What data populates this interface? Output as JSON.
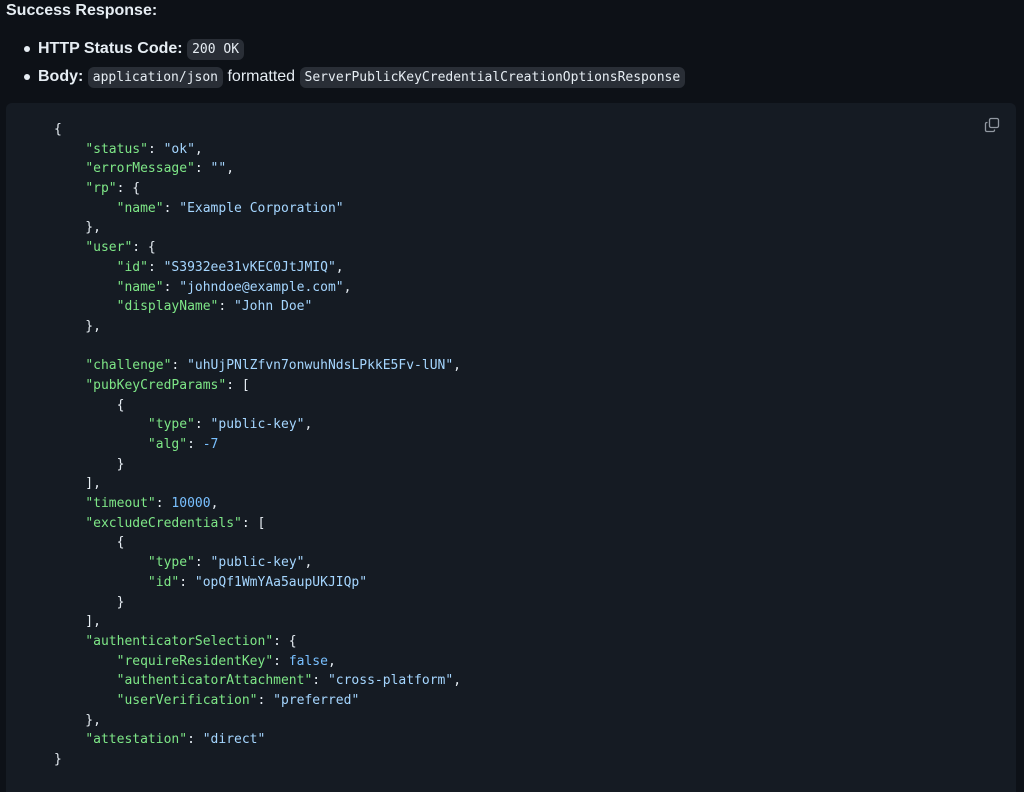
{
  "section_title": "Success Response:",
  "bullets": [
    {
      "label": "HTTP Status Code:",
      "parts": [
        {
          "type": "code",
          "text": "200 OK"
        }
      ]
    },
    {
      "label": "Body:",
      "parts": [
        {
          "type": "code",
          "text": "application/json"
        },
        {
          "type": "text",
          "text": "formatted"
        },
        {
          "type": "code",
          "text": "ServerPublicKeyCredentialCreationOptionsResponse"
        }
      ]
    }
  ],
  "copy_button": {
    "icon": "copy-icon",
    "label": "Copy"
  },
  "code_lines": [
    [
      {
        "t": "p",
        "v": "{"
      }
    ],
    [
      {
        "t": "p",
        "v": "    "
      },
      {
        "t": "k",
        "v": "\"status\""
      },
      {
        "t": "p",
        "v": ": "
      },
      {
        "t": "s",
        "v": "\"ok\""
      },
      {
        "t": "p",
        "v": ","
      }
    ],
    [
      {
        "t": "p",
        "v": "    "
      },
      {
        "t": "k",
        "v": "\"errorMessage\""
      },
      {
        "t": "p",
        "v": ": "
      },
      {
        "t": "s",
        "v": "\"\""
      },
      {
        "t": "p",
        "v": ","
      }
    ],
    [
      {
        "t": "p",
        "v": "    "
      },
      {
        "t": "k",
        "v": "\"rp\""
      },
      {
        "t": "p",
        "v": ": {"
      }
    ],
    [
      {
        "t": "p",
        "v": "        "
      },
      {
        "t": "k",
        "v": "\"name\""
      },
      {
        "t": "p",
        "v": ": "
      },
      {
        "t": "s",
        "v": "\"Example Corporation\""
      }
    ],
    [
      {
        "t": "p",
        "v": "    },"
      }
    ],
    [
      {
        "t": "p",
        "v": "    "
      },
      {
        "t": "k",
        "v": "\"user\""
      },
      {
        "t": "p",
        "v": ": {"
      }
    ],
    [
      {
        "t": "p",
        "v": "        "
      },
      {
        "t": "k",
        "v": "\"id\""
      },
      {
        "t": "p",
        "v": ": "
      },
      {
        "t": "s",
        "v": "\"S3932ee31vKEC0JtJMIQ\""
      },
      {
        "t": "p",
        "v": ","
      }
    ],
    [
      {
        "t": "p",
        "v": "        "
      },
      {
        "t": "k",
        "v": "\"name\""
      },
      {
        "t": "p",
        "v": ": "
      },
      {
        "t": "s",
        "v": "\"johndoe@example.com\""
      },
      {
        "t": "p",
        "v": ","
      }
    ],
    [
      {
        "t": "p",
        "v": "        "
      },
      {
        "t": "k",
        "v": "\"displayName\""
      },
      {
        "t": "p",
        "v": ": "
      },
      {
        "t": "s",
        "v": "\"John Doe\""
      }
    ],
    [
      {
        "t": "p",
        "v": "    },"
      }
    ],
    [
      {
        "t": "p",
        "v": ""
      }
    ],
    [
      {
        "t": "p",
        "v": "    "
      },
      {
        "t": "k",
        "v": "\"challenge\""
      },
      {
        "t": "p",
        "v": ": "
      },
      {
        "t": "s",
        "v": "\"uhUjPNlZfvn7onwuhNdsLPkkE5Fv-lUN\""
      },
      {
        "t": "p",
        "v": ","
      }
    ],
    [
      {
        "t": "p",
        "v": "    "
      },
      {
        "t": "k",
        "v": "\"pubKeyCredParams\""
      },
      {
        "t": "p",
        "v": ": ["
      }
    ],
    [
      {
        "t": "p",
        "v": "        {"
      }
    ],
    [
      {
        "t": "p",
        "v": "            "
      },
      {
        "t": "k",
        "v": "\"type\""
      },
      {
        "t": "p",
        "v": ": "
      },
      {
        "t": "s",
        "v": "\"public-key\""
      },
      {
        "t": "p",
        "v": ","
      }
    ],
    [
      {
        "t": "p",
        "v": "            "
      },
      {
        "t": "k",
        "v": "\"alg\""
      },
      {
        "t": "p",
        "v": ": "
      },
      {
        "t": "n",
        "v": "-7"
      }
    ],
    [
      {
        "t": "p",
        "v": "        }"
      }
    ],
    [
      {
        "t": "p",
        "v": "    ],"
      }
    ],
    [
      {
        "t": "p",
        "v": "    "
      },
      {
        "t": "k",
        "v": "\"timeout\""
      },
      {
        "t": "p",
        "v": ": "
      },
      {
        "t": "n",
        "v": "10000"
      },
      {
        "t": "p",
        "v": ","
      }
    ],
    [
      {
        "t": "p",
        "v": "    "
      },
      {
        "t": "k",
        "v": "\"excludeCredentials\""
      },
      {
        "t": "p",
        "v": ": ["
      }
    ],
    [
      {
        "t": "p",
        "v": "        {"
      }
    ],
    [
      {
        "t": "p",
        "v": "            "
      },
      {
        "t": "k",
        "v": "\"type\""
      },
      {
        "t": "p",
        "v": ": "
      },
      {
        "t": "s",
        "v": "\"public-key\""
      },
      {
        "t": "p",
        "v": ","
      }
    ],
    [
      {
        "t": "p",
        "v": "            "
      },
      {
        "t": "k",
        "v": "\"id\""
      },
      {
        "t": "p",
        "v": ": "
      },
      {
        "t": "s",
        "v": "\"opQf1WmYAa5aupUKJIQp\""
      }
    ],
    [
      {
        "t": "p",
        "v": "        }"
      }
    ],
    [
      {
        "t": "p",
        "v": "    ],"
      }
    ],
    [
      {
        "t": "p",
        "v": "    "
      },
      {
        "t": "k",
        "v": "\"authenticatorSelection\""
      },
      {
        "t": "p",
        "v": ": {"
      }
    ],
    [
      {
        "t": "p",
        "v": "        "
      },
      {
        "t": "k",
        "v": "\"requireResidentKey\""
      },
      {
        "t": "p",
        "v": ": "
      },
      {
        "t": "b",
        "v": "false"
      },
      {
        "t": "p",
        "v": ","
      }
    ],
    [
      {
        "t": "p",
        "v": "        "
      },
      {
        "t": "k",
        "v": "\"authenticatorAttachment\""
      },
      {
        "t": "p",
        "v": ": "
      },
      {
        "t": "s",
        "v": "\"cross-platform\""
      },
      {
        "t": "p",
        "v": ","
      }
    ],
    [
      {
        "t": "p",
        "v": "        "
      },
      {
        "t": "k",
        "v": "\"userVerification\""
      },
      {
        "t": "p",
        "v": ": "
      },
      {
        "t": "s",
        "v": "\"preferred\""
      }
    ],
    [
      {
        "t": "p",
        "v": "    },"
      }
    ],
    [
      {
        "t": "p",
        "v": "    "
      },
      {
        "t": "k",
        "v": "\"attestation\""
      },
      {
        "t": "p",
        "v": ": "
      },
      {
        "t": "s",
        "v": "\"direct\""
      }
    ],
    [
      {
        "t": "p",
        "v": "}"
      }
    ]
  ]
}
